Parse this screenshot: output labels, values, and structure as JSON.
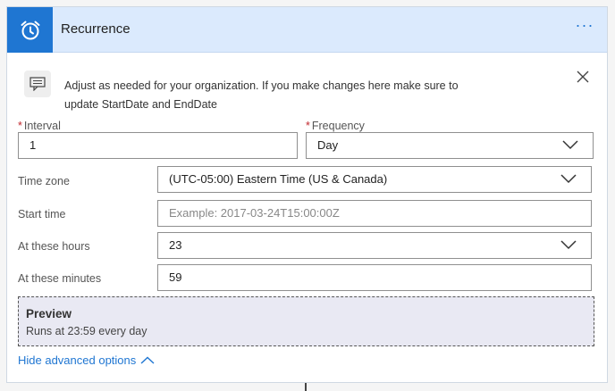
{
  "header": {
    "title": "Recurrence",
    "icon": "alarm-clock-icon",
    "more_label": "···",
    "accent": "#1f76d2"
  },
  "note": {
    "text_line1": "Adjust as needed for your organization. If you make changes here make sure to",
    "text_line2": "update StartDate and EndDate"
  },
  "fields": {
    "interval": {
      "label": "Interval",
      "required_mark": "*",
      "value": "1"
    },
    "frequency": {
      "label": "Frequency",
      "required_mark": "*",
      "value": "Day"
    },
    "time_zone": {
      "label": "Time zone",
      "value": "(UTC-05:00) Eastern Time (US & Canada)"
    },
    "start_time": {
      "label": "Start time",
      "placeholder": "Example: 2017-03-24T15:00:00Z"
    },
    "at_hours": {
      "label": "At these hours",
      "value": "23"
    },
    "at_minutes": {
      "label": "At these minutes",
      "value": "59"
    }
  },
  "preview": {
    "title": "Preview",
    "text": "Runs at 23:59 every day"
  },
  "advanced_link": "Hide advanced options"
}
